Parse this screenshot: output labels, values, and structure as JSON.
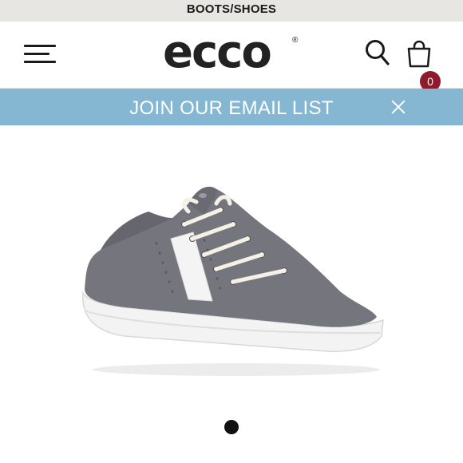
{
  "promo": {
    "text": "BOOTS/SHOES"
  },
  "header": {
    "menu_icon": "hamburger-menu-icon",
    "logo_text": "ecco",
    "logo_registered": "®",
    "search_icon": "search-icon",
    "bag_icon": "shopping-bag-icon",
    "bag_count": "0",
    "badge_color": "#8e1a2b"
  },
  "email_bar": {
    "text": "JOIN OUR EMAIL LIST",
    "close_icon": "close-icon",
    "background": "#85b7d3"
  },
  "product": {
    "image": "grey-sneaker-white-stripe",
    "colors": {
      "upper": "#75757d",
      "stripe": "#f5f5f5",
      "sole": "#f2f2f2"
    }
  },
  "carousel": {
    "active_index": 1,
    "count": 1
  }
}
